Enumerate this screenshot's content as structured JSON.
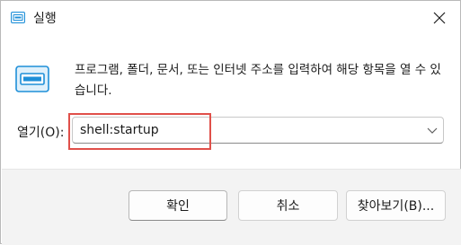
{
  "window": {
    "title": "실행",
    "icon": "run-icon",
    "close_icon": "close-icon"
  },
  "dialog": {
    "description": "프로그램, 폴더, 문서, 또는 인터넷 주소를 입력하여 해당 항목을 열 수 있습니다.",
    "open_label": "열기(O):",
    "open_value": "shell:startup",
    "dropdown_icon": "chevron-down-icon"
  },
  "buttons": {
    "ok": "확인",
    "cancel": "취소",
    "browse": "찾아보기(B)..."
  },
  "colors": {
    "highlight": "#e0504a",
    "icon_blue": "#1e8fd8",
    "footer_bg": "#f3f3f3"
  }
}
